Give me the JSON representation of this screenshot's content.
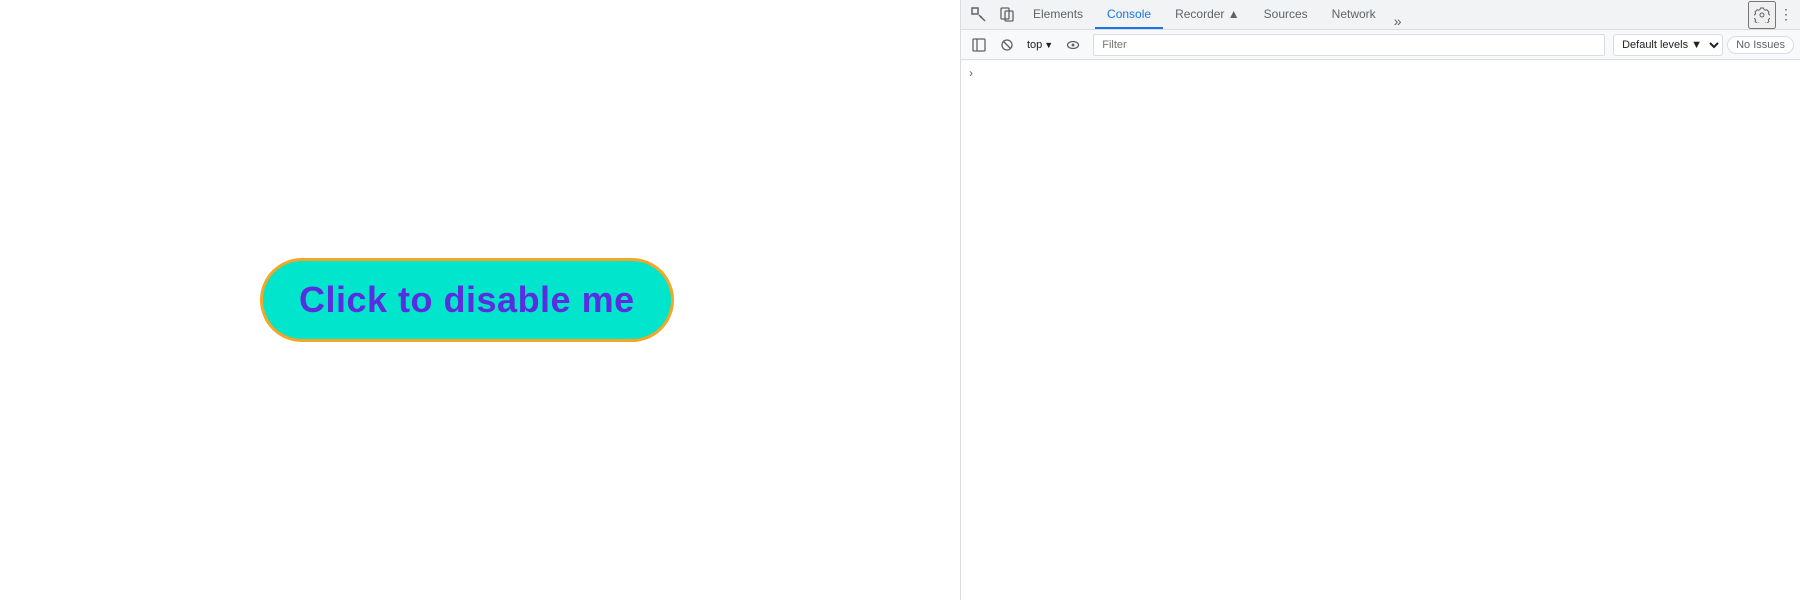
{
  "page": {
    "button_label": "Click to disable me",
    "button_bg": "#00e5cc",
    "button_border": "#f5a623",
    "button_text_color": "#5b2de0"
  },
  "devtools": {
    "tabs": [
      {
        "label": "Elements",
        "active": false
      },
      {
        "label": "Console",
        "active": true
      },
      {
        "label": "Recorder ▲",
        "active": false
      },
      {
        "label": "Sources",
        "active": false
      },
      {
        "label": "Network",
        "active": false
      }
    ],
    "more_tabs": "»",
    "console_bar": {
      "top_label": "top",
      "filter_placeholder": "Filter",
      "levels_label": "Default levels ▼",
      "no_issues": "No Issues"
    },
    "icons": {
      "inspect": "⬚",
      "device": "⬜",
      "clear": "🚫",
      "eye": "👁",
      "settings": "⚙",
      "more_vert": "⋮",
      "chevron_right": "›"
    }
  }
}
